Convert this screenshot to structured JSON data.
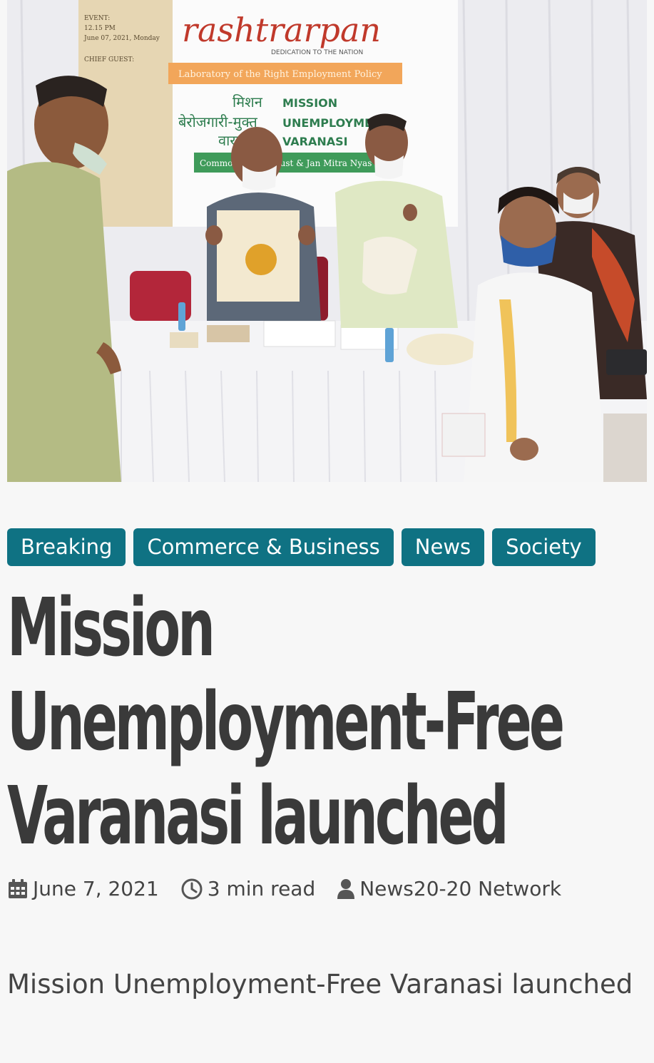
{
  "hero": {
    "banner_brand": "rashtrarpan",
    "banner_tagline": "DEDICATION TO THE NATION",
    "banner_subtitle": "Laboratory of the Right Employment Policy",
    "banner_hindi_1": "मिशन",
    "banner_english_1": "MISSION",
    "banner_hindi_2": "बेरोजगारी-मुक्त",
    "banner_english_2": "UNEMPLOYMENT-F",
    "banner_hindi_3": "वाराणसी",
    "banner_english_3": "VARANASI",
    "banner_strip": "Commonwealth Trust & Jan Mitra Nyas",
    "event_label": "EVENT:",
    "event_time": "12.15 PM",
    "event_date": "June 07, 2021, Monday",
    "chief_guest": "CHIEF GUEST:"
  },
  "categories": [
    "Breaking",
    "Commerce & Business",
    "News",
    "Society"
  ],
  "article": {
    "title": "Mission Unemployment-Free Varanasi launched",
    "date": "June 7, 2021",
    "read_time": "3 min read",
    "author": "News20-20 Network",
    "excerpt": "Mission Unemployment-Free Varanasi launched"
  },
  "colors": {
    "category_bg": "#0f7283",
    "title": "#3a3a3a",
    "background": "#f7f7f7"
  },
  "icons": [
    "calendar-icon",
    "clock-icon",
    "user-icon"
  ]
}
